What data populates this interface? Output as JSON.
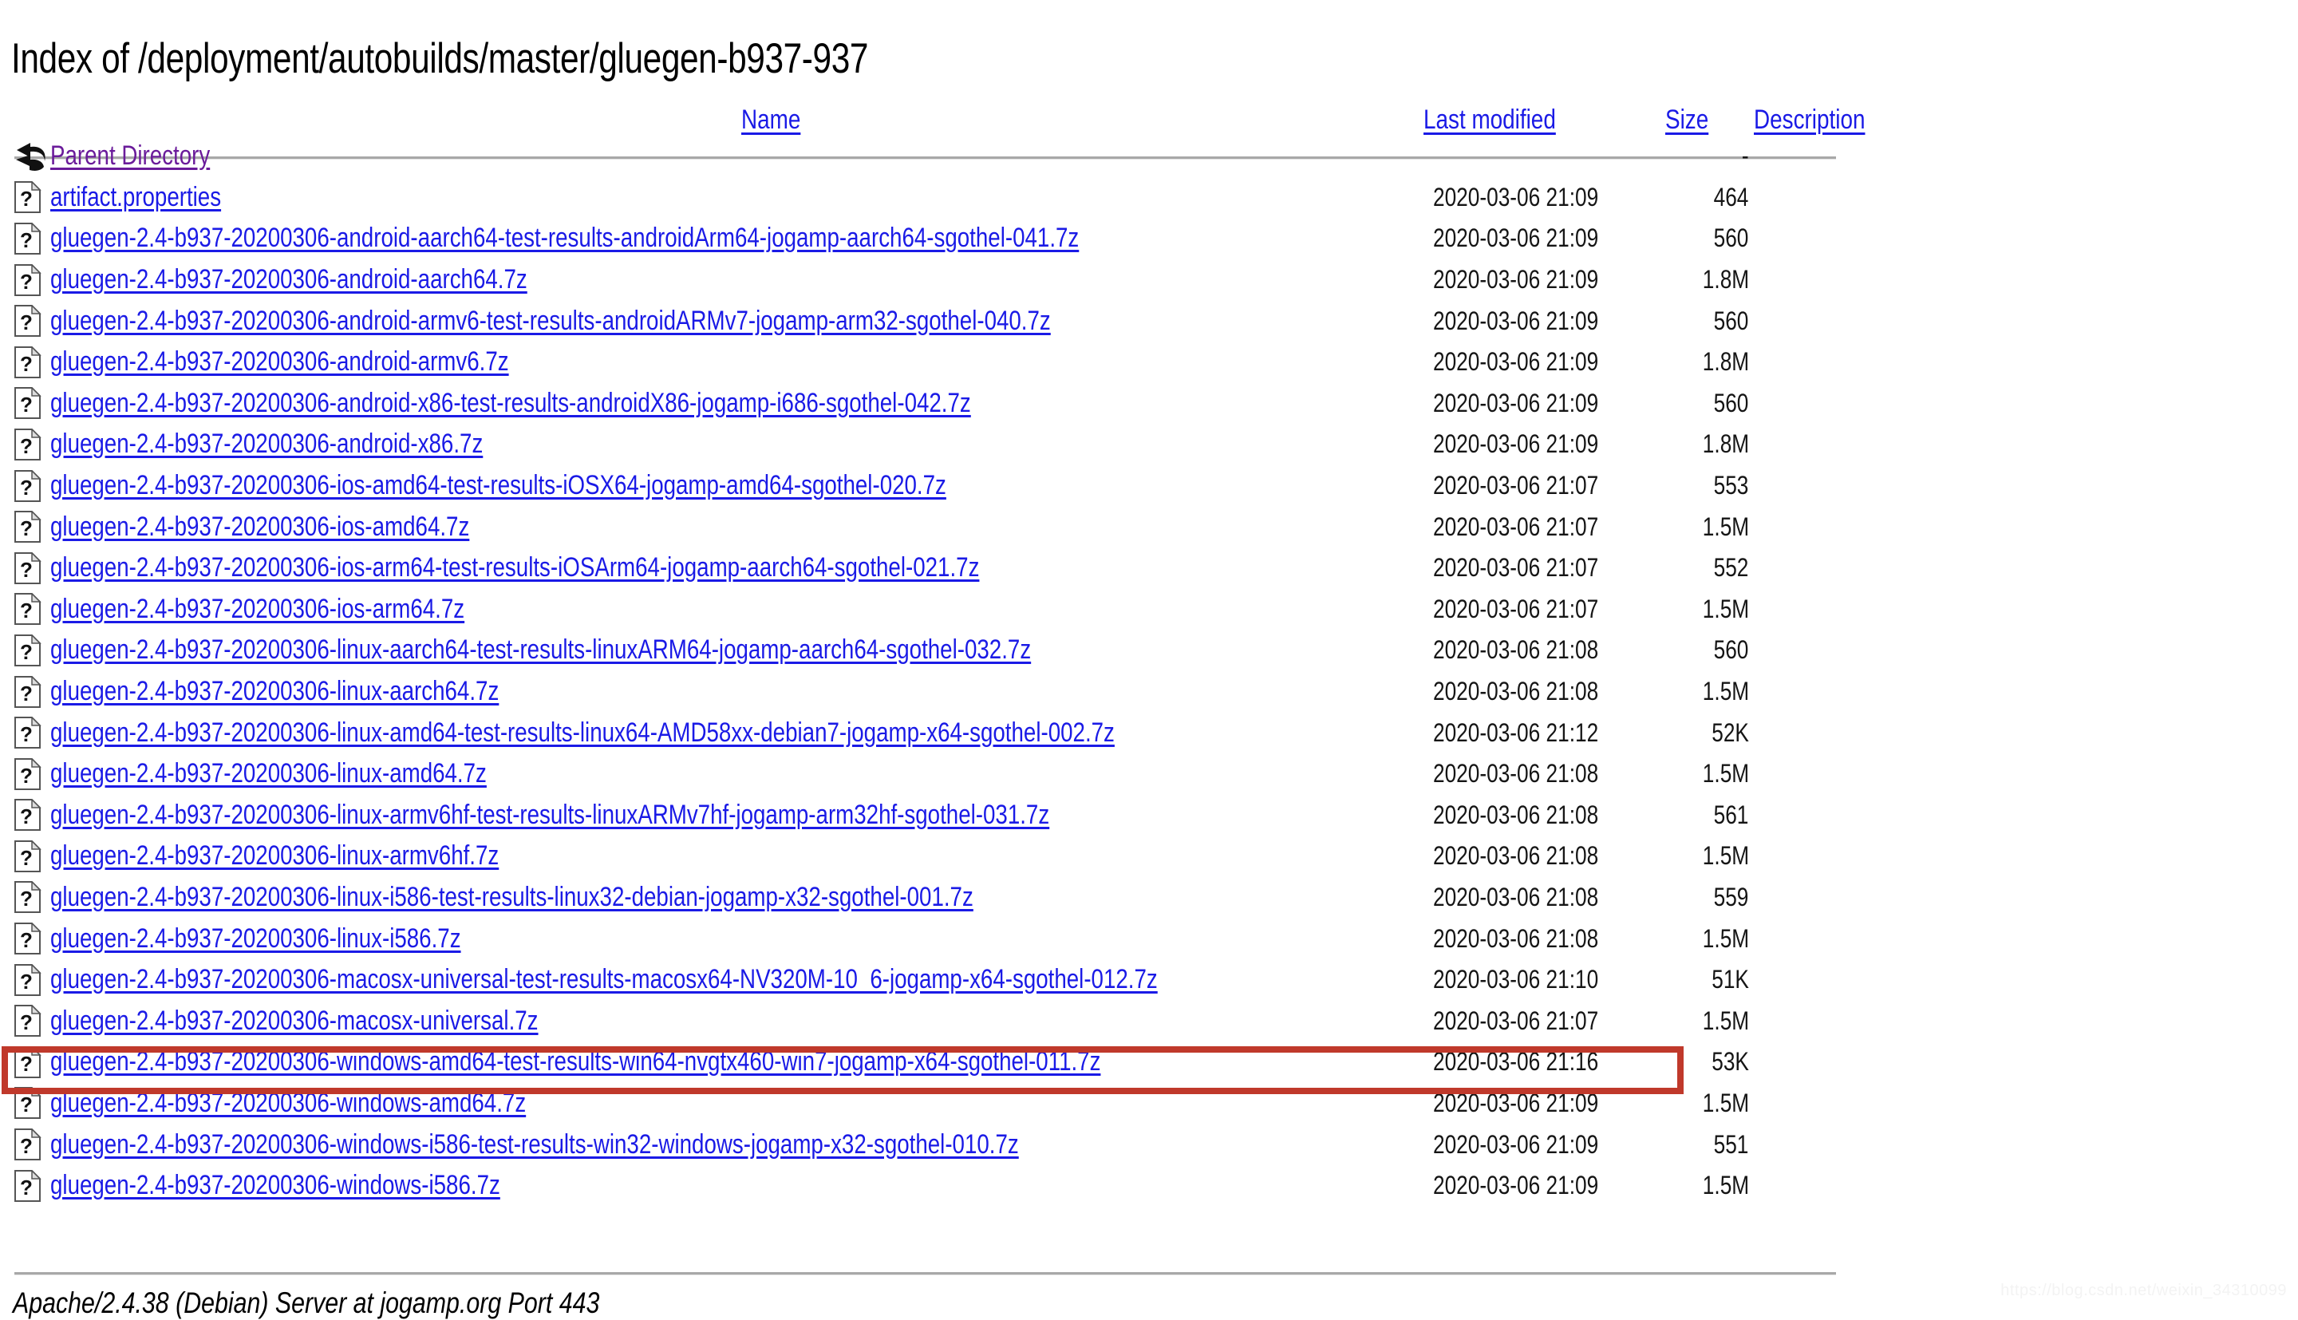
{
  "page": {
    "title": "Index of /deployment/autobuilds/master/gluegen-b937-937",
    "footer": "Apache/2.4.38 (Debian) Server at jogamp.org Port 443",
    "watermark": "https://blog.csdn.net/weixin_34310099"
  },
  "colors": {
    "link": "#1a1ae6",
    "visited_link": "#6a1b9a",
    "highlight": "#c0392b",
    "rule": "#a8a8a8",
    "text": "#151515"
  },
  "table": {
    "headers": {
      "name": "Name",
      "last_modified": "Last modified",
      "size": "Size",
      "description": "Description"
    },
    "rows": [
      {
        "icon": "back-arrow-icon",
        "name": "Parent Directory",
        "visited": true,
        "last_modified": "",
        "size": "-",
        "description": ""
      },
      {
        "icon": "unknown-file-icon",
        "name": "artifact.properties",
        "visited": false,
        "last_modified": "2020-03-06 21:09",
        "size": "464",
        "description": ""
      },
      {
        "icon": "unknown-file-icon",
        "name": "gluegen-2.4-b937-20200306-android-aarch64-test-results-androidArm64-jogamp-aarch64-sgothel-041.7z",
        "visited": false,
        "last_modified": "2020-03-06 21:09",
        "size": "560",
        "description": ""
      },
      {
        "icon": "unknown-file-icon",
        "name": "gluegen-2.4-b937-20200306-android-aarch64.7z",
        "visited": false,
        "last_modified": "2020-03-06 21:09",
        "size": "1.8M",
        "description": ""
      },
      {
        "icon": "unknown-file-icon",
        "name": "gluegen-2.4-b937-20200306-android-armv6-test-results-androidARMv7-jogamp-arm32-sgothel-040.7z",
        "visited": false,
        "last_modified": "2020-03-06 21:09",
        "size": "560",
        "description": ""
      },
      {
        "icon": "unknown-file-icon",
        "name": "gluegen-2.4-b937-20200306-android-armv6.7z",
        "visited": false,
        "last_modified": "2020-03-06 21:09",
        "size": "1.8M",
        "description": ""
      },
      {
        "icon": "unknown-file-icon",
        "name": "gluegen-2.4-b937-20200306-android-x86-test-results-androidX86-jogamp-i686-sgothel-042.7z",
        "visited": false,
        "last_modified": "2020-03-06 21:09",
        "size": "560",
        "description": ""
      },
      {
        "icon": "unknown-file-icon",
        "name": "gluegen-2.4-b937-20200306-android-x86.7z",
        "visited": false,
        "last_modified": "2020-03-06 21:09",
        "size": "1.8M",
        "description": ""
      },
      {
        "icon": "unknown-file-icon",
        "name": "gluegen-2.4-b937-20200306-ios-amd64-test-results-iOSX64-jogamp-amd64-sgothel-020.7z",
        "visited": false,
        "last_modified": "2020-03-06 21:07",
        "size": "553",
        "description": ""
      },
      {
        "icon": "unknown-file-icon",
        "name": "gluegen-2.4-b937-20200306-ios-amd64.7z",
        "visited": false,
        "last_modified": "2020-03-06 21:07",
        "size": "1.5M",
        "description": ""
      },
      {
        "icon": "unknown-file-icon",
        "name": "gluegen-2.4-b937-20200306-ios-arm64-test-results-iOSArm64-jogamp-aarch64-sgothel-021.7z",
        "visited": false,
        "last_modified": "2020-03-06 21:07",
        "size": "552",
        "description": ""
      },
      {
        "icon": "unknown-file-icon",
        "name": "gluegen-2.4-b937-20200306-ios-arm64.7z",
        "visited": false,
        "last_modified": "2020-03-06 21:07",
        "size": "1.5M",
        "description": ""
      },
      {
        "icon": "unknown-file-icon",
        "name": "gluegen-2.4-b937-20200306-linux-aarch64-test-results-linuxARM64-jogamp-aarch64-sgothel-032.7z",
        "visited": false,
        "last_modified": "2020-03-06 21:08",
        "size": "560",
        "description": ""
      },
      {
        "icon": "unknown-file-icon",
        "name": "gluegen-2.4-b937-20200306-linux-aarch64.7z",
        "visited": false,
        "last_modified": "2020-03-06 21:08",
        "size": "1.5M",
        "description": ""
      },
      {
        "icon": "unknown-file-icon",
        "name": "gluegen-2.4-b937-20200306-linux-amd64-test-results-linux64-AMD58xx-debian7-jogamp-x64-sgothel-002.7z",
        "visited": false,
        "last_modified": "2020-03-06 21:12",
        "size": "52K",
        "description": ""
      },
      {
        "icon": "unknown-file-icon",
        "name": "gluegen-2.4-b937-20200306-linux-amd64.7z",
        "visited": false,
        "last_modified": "2020-03-06 21:08",
        "size": "1.5M",
        "description": ""
      },
      {
        "icon": "unknown-file-icon",
        "name": "gluegen-2.4-b937-20200306-linux-armv6hf-test-results-linuxARMv7hf-jogamp-arm32hf-sgothel-031.7z",
        "visited": false,
        "last_modified": "2020-03-06 21:08",
        "size": "561",
        "description": ""
      },
      {
        "icon": "unknown-file-icon",
        "name": "gluegen-2.4-b937-20200306-linux-armv6hf.7z",
        "visited": false,
        "last_modified": "2020-03-06 21:08",
        "size": "1.5M",
        "description": ""
      },
      {
        "icon": "unknown-file-icon",
        "name": "gluegen-2.4-b937-20200306-linux-i586-test-results-linux32-debian-jogamp-x32-sgothel-001.7z",
        "visited": false,
        "last_modified": "2020-03-06 21:08",
        "size": "559",
        "description": ""
      },
      {
        "icon": "unknown-file-icon",
        "name": "gluegen-2.4-b937-20200306-linux-i586.7z",
        "visited": false,
        "last_modified": "2020-03-06 21:08",
        "size": "1.5M",
        "description": ""
      },
      {
        "icon": "unknown-file-icon",
        "name": "gluegen-2.4-b937-20200306-macosx-universal-test-results-macosx64-NV320M-10_6-jogamp-x64-sgothel-012.7z",
        "visited": false,
        "last_modified": "2020-03-06 21:10",
        "size": "51K",
        "description": ""
      },
      {
        "icon": "unknown-file-icon",
        "name": "gluegen-2.4-b937-20200306-macosx-universal.7z",
        "visited": false,
        "last_modified": "2020-03-06 21:07",
        "size": "1.5M",
        "description": "",
        "highlighted": true
      },
      {
        "icon": "unknown-file-icon",
        "name": "gluegen-2.4-b937-20200306-windows-amd64-test-results-win64-nvgtx460-win7-jogamp-x64-sgothel-011.7z",
        "visited": false,
        "last_modified": "2020-03-06 21:16",
        "size": "53K",
        "description": ""
      },
      {
        "icon": "unknown-file-icon",
        "name": "gluegen-2.4-b937-20200306-windows-amd64.7z",
        "visited": false,
        "last_modified": "2020-03-06 21:09",
        "size": "1.5M",
        "description": ""
      },
      {
        "icon": "unknown-file-icon",
        "name": "gluegen-2.4-b937-20200306-windows-i586-test-results-win32-windows-jogamp-x32-sgothel-010.7z",
        "visited": false,
        "last_modified": "2020-03-06 21:09",
        "size": "551",
        "description": ""
      },
      {
        "icon": "unknown-file-icon",
        "name": "gluegen-2.4-b937-20200306-windows-i586.7z",
        "visited": false,
        "last_modified": "2020-03-06 21:09",
        "size": "1.5M",
        "description": ""
      }
    ]
  }
}
